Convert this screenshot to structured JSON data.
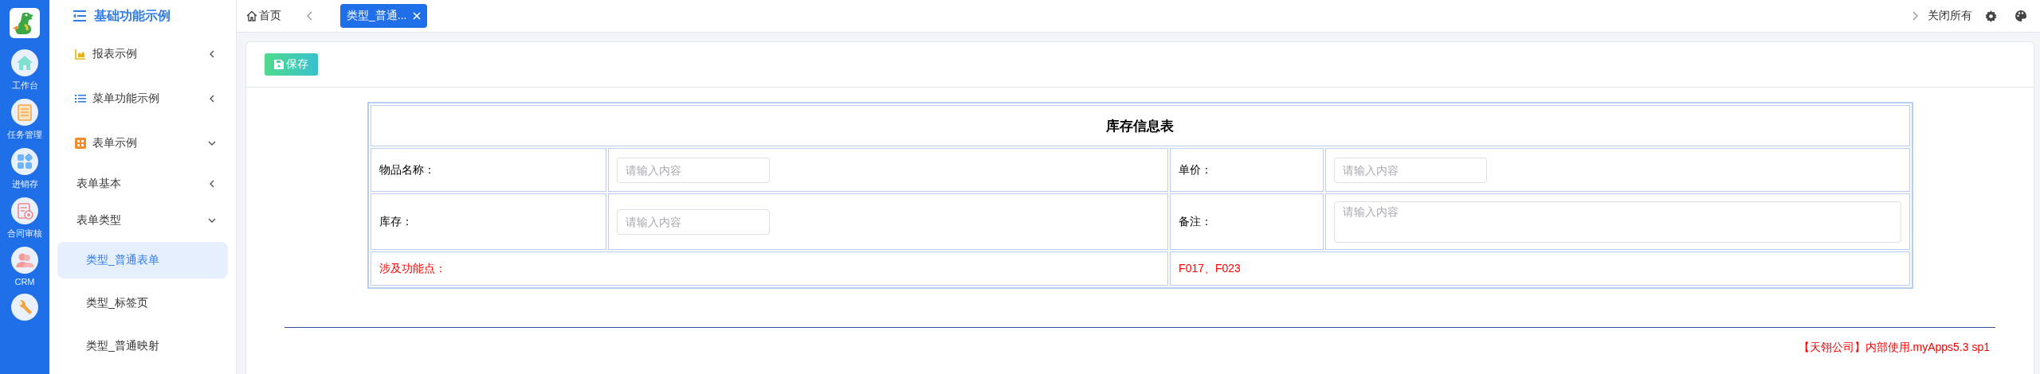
{
  "rail": {
    "items": [
      {
        "label": "工作台"
      },
      {
        "label": "任务管理"
      },
      {
        "label": "进销存"
      },
      {
        "label": "合同审核"
      },
      {
        "label": "CRM"
      }
    ]
  },
  "sidebar": {
    "title": "基础功能示例",
    "items": [
      {
        "label": "报表示例",
        "expanded": false
      },
      {
        "label": "菜单功能示例",
        "expanded": false
      },
      {
        "label": "表单示例",
        "expanded": true,
        "children": [
          {
            "label": "表单基本",
            "expanded": false
          },
          {
            "label": "表单类型",
            "expanded": true,
            "children": [
              {
                "label": "类型_普通表单",
                "selected": true
              },
              {
                "label": "类型_标签页",
                "selected": false
              },
              {
                "label": "类型_普通映射",
                "selected": false
              }
            ]
          }
        ]
      }
    ]
  },
  "tabbar": {
    "home": "首页",
    "tabs": [
      {
        "label": "类型_普通...",
        "selected": true
      }
    ],
    "close_all": "关闭所有"
  },
  "toolbar": {
    "save_button": "保存"
  },
  "form": {
    "title": "库存信息表",
    "rows": [
      [
        {
          "label": "物品名称：",
          "placeholder": "请输入内容",
          "kind": "input"
        },
        {
          "label": "单价：",
          "placeholder": "请输入内容",
          "kind": "input"
        }
      ],
      [
        {
          "label": "库存：",
          "placeholder": "请输入内容",
          "kind": "input"
        },
        {
          "label": "备注：",
          "placeholder": "请输入内容",
          "kind": "textarea"
        }
      ]
    ],
    "note": {
      "label": "涉及功能点：",
      "value": "F017、F023"
    }
  },
  "footer": "【天翎公司】内部使用.myApps5.3 sp1"
}
